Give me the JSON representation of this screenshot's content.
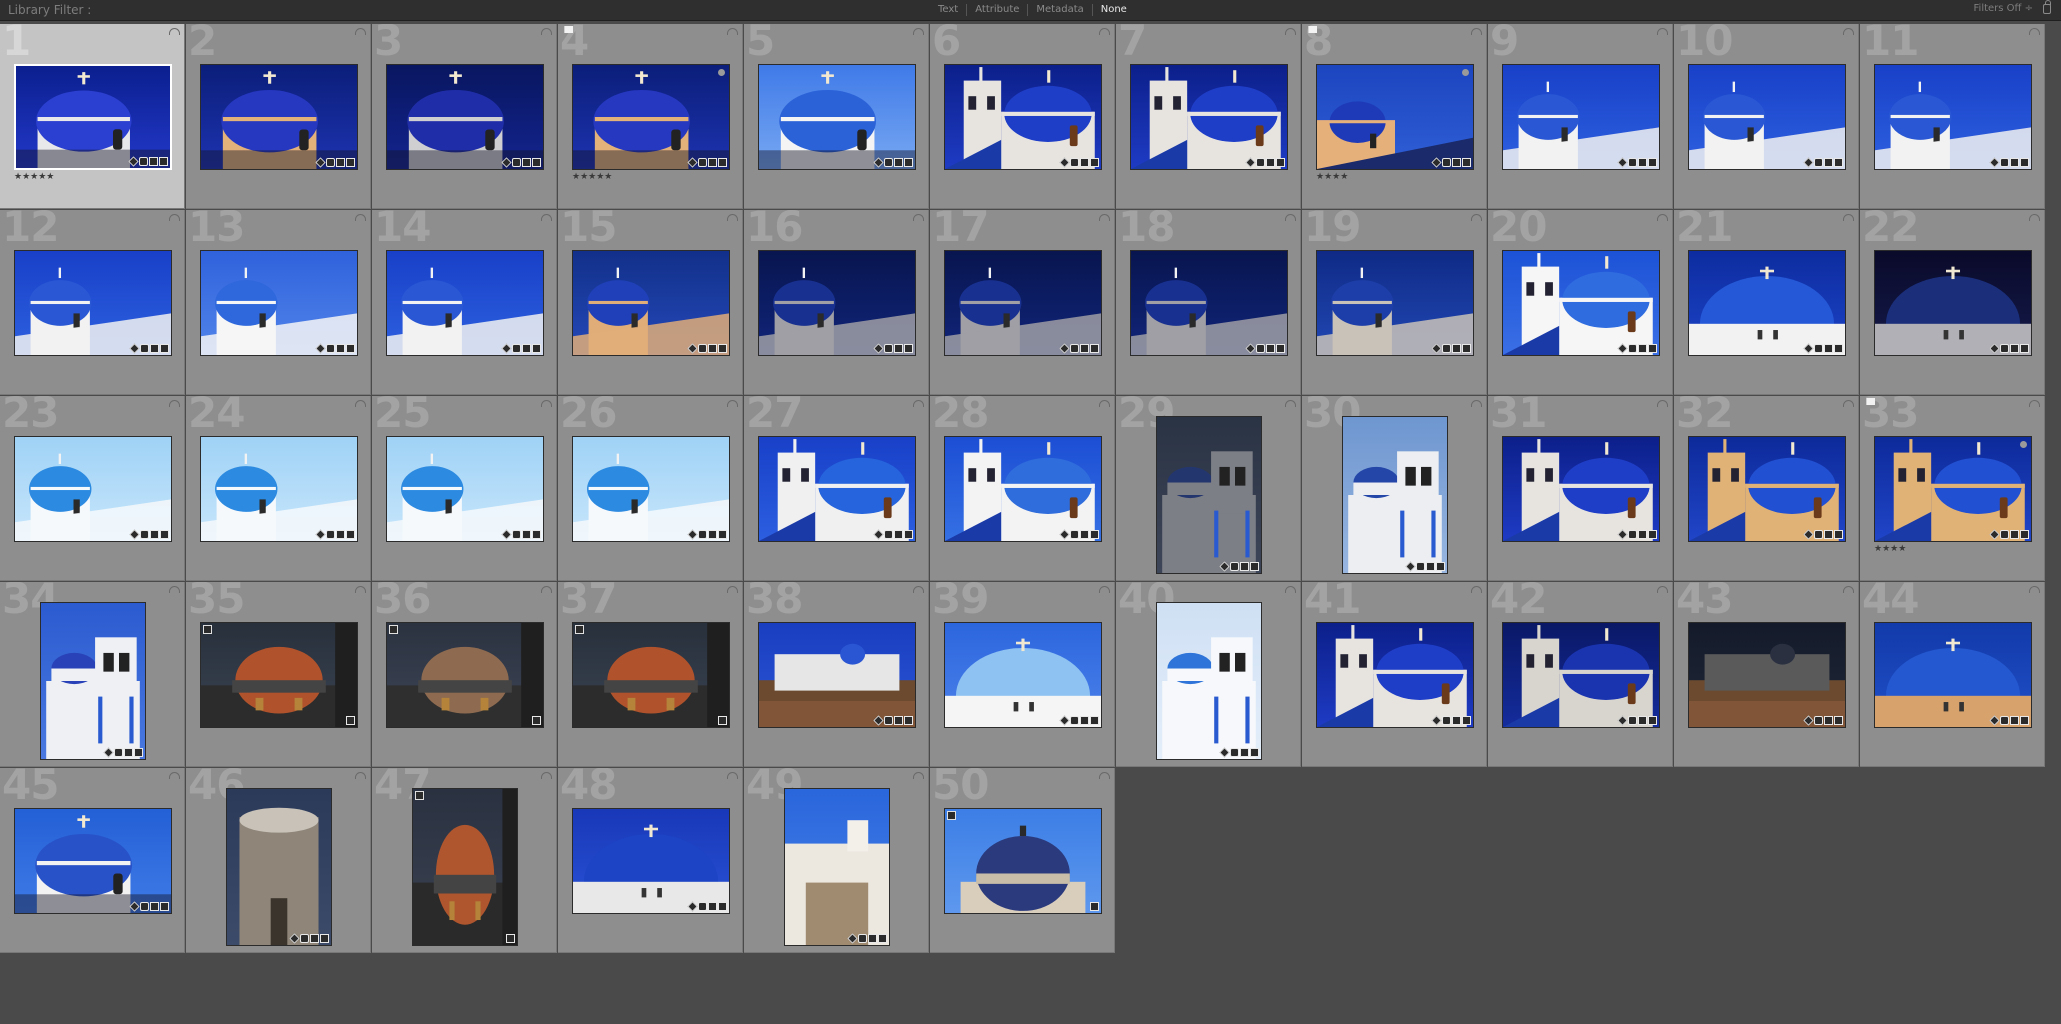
{
  "filter_bar": {
    "label": "Library Filter :",
    "modes": [
      "Text",
      "Attribute",
      "Metadata",
      "None"
    ],
    "active_mode": "None",
    "filters_status": "Filters Off ÷"
  },
  "photos": [
    {
      "num": "1",
      "scene": "dome-white",
      "orient": "land",
      "sel": true,
      "stars": "★★★★★",
      "flag": false
    },
    {
      "num": "2",
      "scene": "dome-tan",
      "orient": "land"
    },
    {
      "num": "3",
      "scene": "dome-white-dark",
      "orient": "land"
    },
    {
      "num": "4",
      "scene": "dome-tan",
      "orient": "land",
      "flag": true,
      "stars": "★★★★★",
      "dot": true
    },
    {
      "num": "5",
      "scene": "dome-light",
      "orient": "land"
    },
    {
      "num": "6",
      "scene": "bell-two",
      "orient": "land"
    },
    {
      "num": "7",
      "scene": "bell-two",
      "orient": "land"
    },
    {
      "num": "8",
      "scene": "dome-tan-small",
      "orient": "land",
      "flag": true,
      "stars": "★★★★",
      "dot": true
    },
    {
      "num": "9",
      "scene": "side-dome",
      "orient": "land"
    },
    {
      "num": "10",
      "scene": "side-dome",
      "orient": "land"
    },
    {
      "num": "11",
      "scene": "side-dome",
      "orient": "land"
    },
    {
      "num": "12",
      "scene": "side-dome",
      "orient": "land"
    },
    {
      "num": "13",
      "scene": "side-dome-bright",
      "orient": "land"
    },
    {
      "num": "14",
      "scene": "side-dome",
      "orient": "land"
    },
    {
      "num": "15",
      "scene": "side-dome-tan",
      "orient": "land"
    },
    {
      "num": "16",
      "scene": "side-dome-dark",
      "orient": "land"
    },
    {
      "num": "17",
      "scene": "side-dome-dark",
      "orient": "land"
    },
    {
      "num": "18",
      "scene": "side-dome-dark",
      "orient": "land"
    },
    {
      "num": "19",
      "scene": "side-dome-grey",
      "orient": "land"
    },
    {
      "num": "20",
      "scene": "bell-bright",
      "orient": "land"
    },
    {
      "num": "21",
      "scene": "big-dome",
      "orient": "land"
    },
    {
      "num": "22",
      "scene": "big-dome-dark",
      "orient": "land"
    },
    {
      "num": "23",
      "scene": "pale-dome",
      "orient": "land"
    },
    {
      "num": "24",
      "scene": "pale-dome",
      "orient": "land"
    },
    {
      "num": "25",
      "scene": "pale-dome",
      "orient": "land"
    },
    {
      "num": "26",
      "scene": "pale-dome",
      "orient": "land"
    },
    {
      "num": "27",
      "scene": "bell-dome-blue",
      "orient": "land"
    },
    {
      "num": "28",
      "scene": "bell-tower-wide",
      "orient": "land"
    },
    {
      "num": "29",
      "scene": "bell-portrait-dark",
      "orient": "port"
    },
    {
      "num": "30",
      "scene": "bell-portrait-light",
      "orient": "port"
    },
    {
      "num": "31",
      "scene": "bell-two",
      "orient": "land"
    },
    {
      "num": "32",
      "scene": "bell-tan",
      "orient": "land"
    },
    {
      "num": "33",
      "scene": "bell-tan",
      "orient": "land",
      "flag": true,
      "stars": "★★★★",
      "dot": true
    },
    {
      "num": "34",
      "scene": "bell-portrait-blue",
      "orient": "port"
    },
    {
      "num": "35",
      "scene": "brick-dome",
      "orient": "land",
      "stack": true
    },
    {
      "num": "36",
      "scene": "brick-dome-grey",
      "orient": "land",
      "stack": true
    },
    {
      "num": "37",
      "scene": "brick-dome",
      "orient": "land",
      "stack": true
    },
    {
      "num": "38",
      "scene": "village",
      "orient": "land"
    },
    {
      "num": "39",
      "scene": "big-dome-light",
      "orient": "land"
    },
    {
      "num": "40",
      "scene": "bell-portrait-pale",
      "orient": "port"
    },
    {
      "num": "41",
      "scene": "bell-two",
      "orient": "land"
    },
    {
      "num": "42",
      "scene": "bell-two-dark",
      "orient": "land"
    },
    {
      "num": "43",
      "scene": "night-town",
      "orient": "land"
    },
    {
      "num": "44",
      "scene": "big-dome-tan",
      "orient": "land"
    },
    {
      "num": "45",
      "scene": "round-dome",
      "orient": "land"
    },
    {
      "num": "46",
      "scene": "windmill",
      "orient": "port"
    },
    {
      "num": "47",
      "scene": "brick-dome-portrait",
      "orient": "port",
      "stack": true
    },
    {
      "num": "48",
      "scene": "big-dome-deep",
      "orient": "land"
    },
    {
      "num": "49",
      "scene": "white-house",
      "orient": "port"
    },
    {
      "num": "50",
      "scene": "mosaic-dome",
      "orient": "land",
      "stack": true
    }
  ]
}
